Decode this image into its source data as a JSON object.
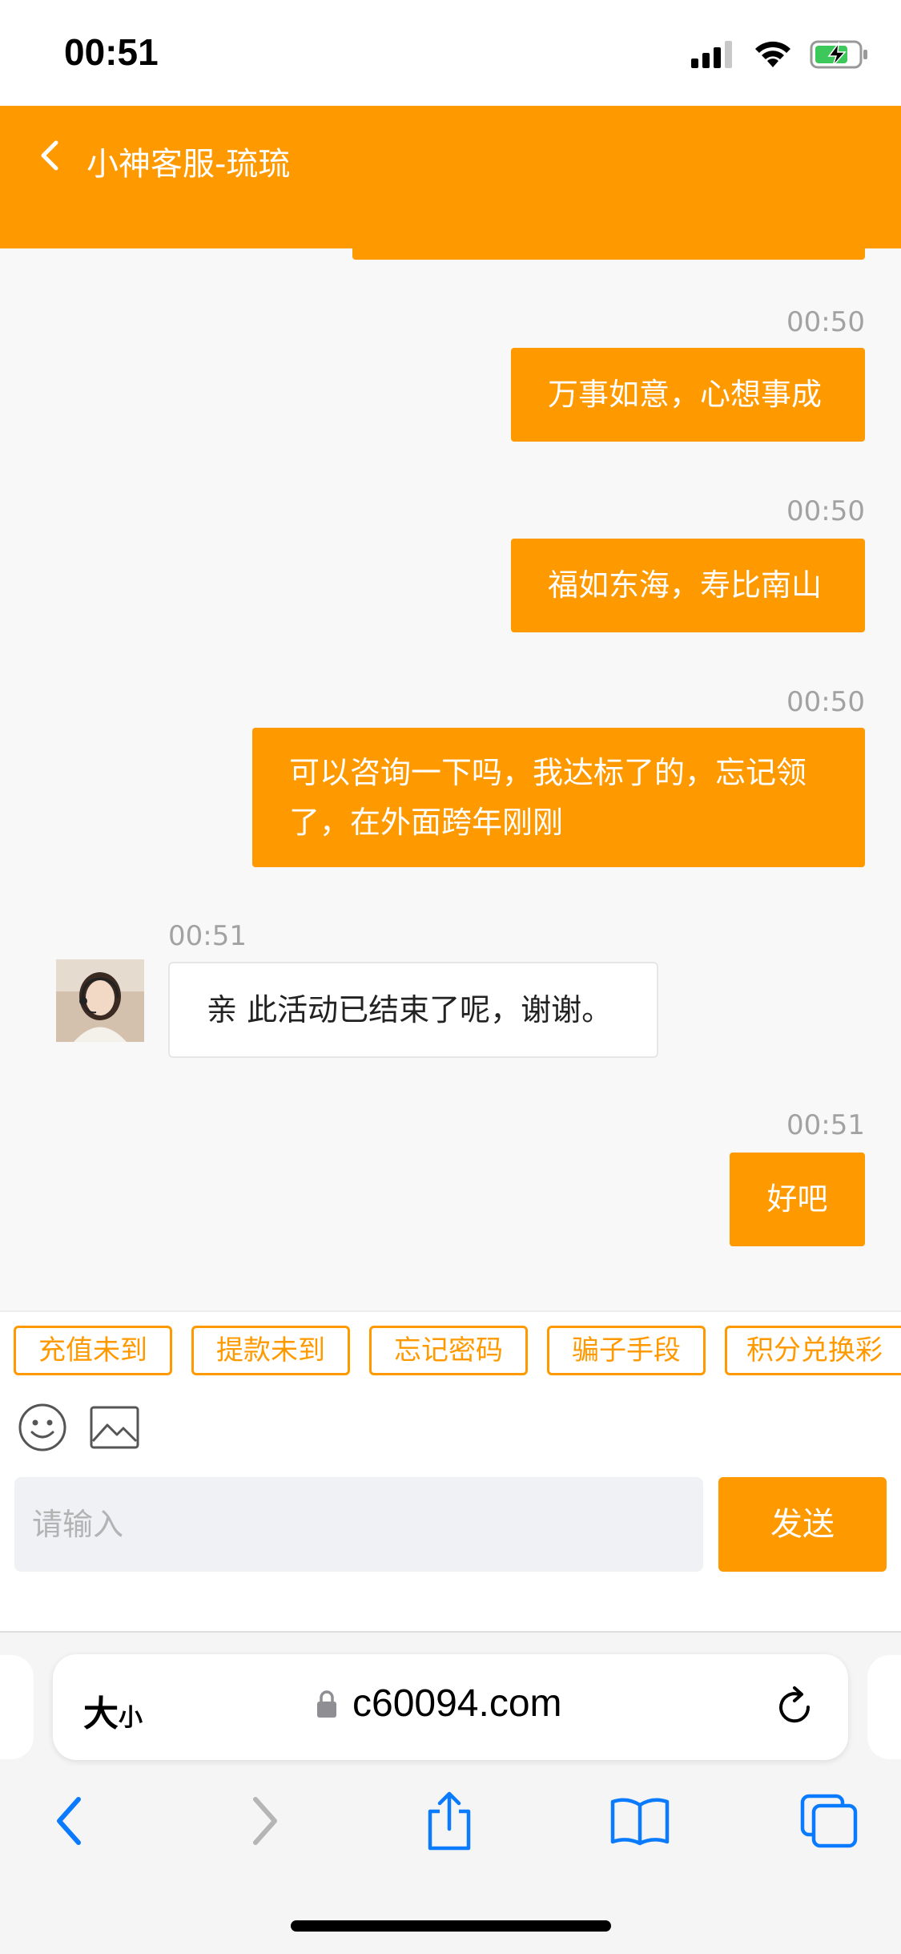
{
  "status_bar": {
    "time": "00:51"
  },
  "header": {
    "title": "小神客服-琉琉"
  },
  "messages": [
    {
      "time": "00:50",
      "text": "万事如意，心想事成",
      "direction": "out"
    },
    {
      "time": "00:50",
      "text": "福如东海，寿比南山",
      "direction": "out"
    },
    {
      "time": "00:50",
      "text_line1": "可以咨询一下吗，我达标了的，忘记领",
      "text_line2": "了，在外面跨年刚刚",
      "direction": "out"
    },
    {
      "time": "00:51",
      "text": "亲 此活动已结束了呢，谢谢。",
      "direction": "in"
    },
    {
      "time": "00:51",
      "text": "好吧",
      "direction": "out"
    }
  ],
  "quick_replies": [
    "充值未到",
    "提款未到",
    "忘记密码",
    "骗子手段",
    "积分兑换彩"
  ],
  "composer": {
    "placeholder": "请输入",
    "send_label": "发送"
  },
  "browser": {
    "aa_big": "大",
    "aa_small": "小",
    "url": "c60094.com"
  },
  "colors": {
    "accent": "#ff9900",
    "chat_bg": "#f8f8f8",
    "timestamp": "#a2a2a2",
    "ios_blue": "#0a7aff"
  },
  "icons": [
    "back-chevron-icon",
    "emoji-icon",
    "image-icon",
    "lock-icon",
    "reload-icon",
    "back-icon",
    "forward-icon",
    "share-icon",
    "bookmarks-icon",
    "tabs-icon"
  ]
}
